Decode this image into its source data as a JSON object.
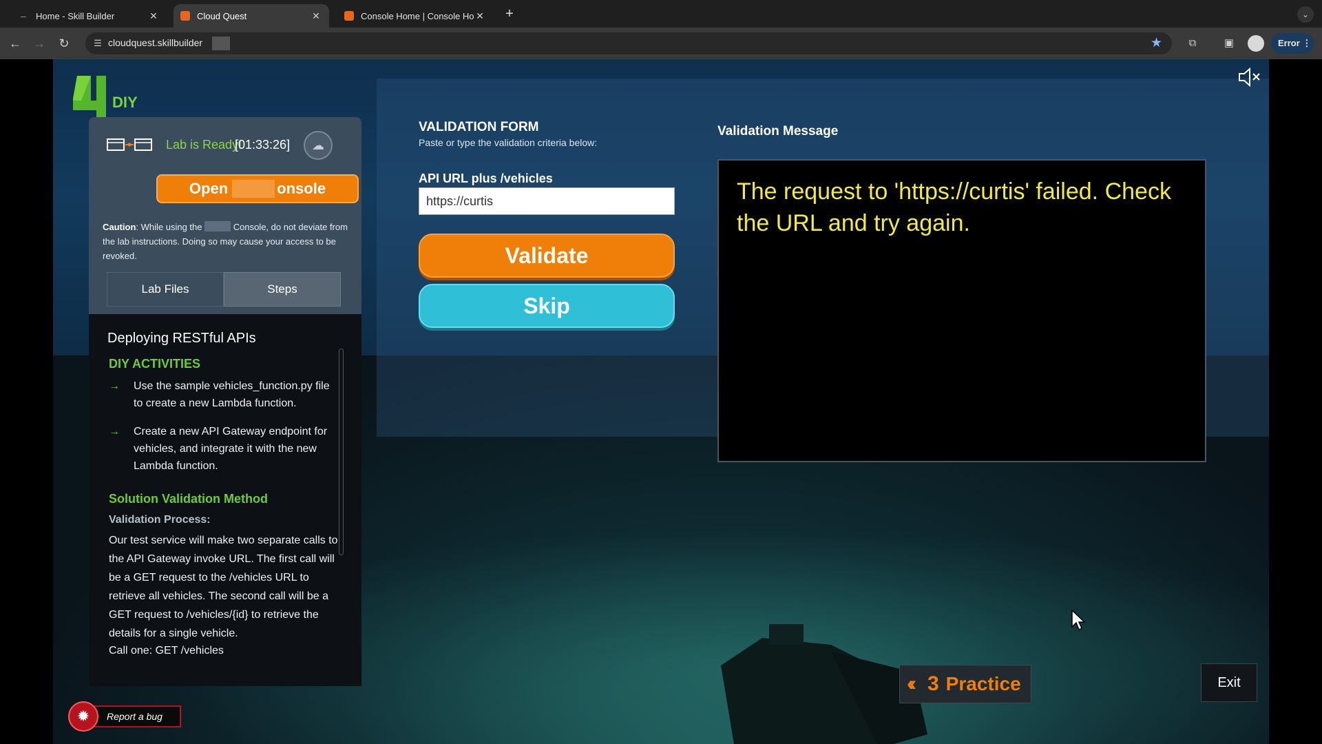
{
  "browser": {
    "tabs": [
      {
        "title": "Home - Skill Builder",
        "active": false
      },
      {
        "title": "Cloud Quest",
        "active": true
      },
      {
        "title": "Console Home | Console Ho",
        "active": false
      }
    ],
    "url": "cloudquest.skillbuilder",
    "error_chip": "Error"
  },
  "game": {
    "level_number": "4",
    "mode_label": "DIY",
    "lab": {
      "status": "Lab is Ready!",
      "timer": "[01:33:26]",
      "open_button_part1": "Open",
      "open_button_part2": "onsole",
      "caution_label": "Caution",
      "caution_text_1": ": While using the ",
      "caution_text_2": " Console, do not deviate from the lab instructions. Doing so may cause your access to be revoked.",
      "tab_lab_files": "Lab Files",
      "tab_steps": "Steps"
    },
    "steps": {
      "title": "Deploying RESTful APIs",
      "diy_heading": "DIY ACTIVITIES",
      "activities": [
        "Use the sample vehicles_function.py file to create a new Lambda function.",
        "Create a new API Gateway endpoint for vehicles, and integrate it with the new Lambda function."
      ],
      "solution_heading": "Solution Validation Method",
      "validation_process_heading": "Validation Process:",
      "validation_process_text": "Our test service will make two separate calls to the API Gateway invoke URL. The first call will be a GET request to the /vehicles URL to retrieve all vehicles. The second call will be a GET request to /vehicles/{id} to retrieve the details for a single vehicle.",
      "call_one": "Call one: GET /vehicles"
    },
    "validation_form": {
      "title": "VALIDATION FORM",
      "subtitle": "Paste or type the validation criteria below:",
      "field_label": "API URL plus /vehicles",
      "field_value": "https://curtis",
      "validate_label": "Validate",
      "skip_label": "Skip"
    },
    "validation_message": {
      "title": "Validation Message",
      "text": "The request to 'https://curtis' failed. Check the URL and try again."
    },
    "practice": {
      "number": "3",
      "label": "Practice"
    },
    "exit_label": "Exit",
    "report_bug_label": "Report a bug",
    "colors": {
      "accent_orange": "#f07f0a",
      "skip_cyan": "#2fbfd6",
      "green": "#6ecb3a",
      "message_yellow": "#f2e94a"
    }
  }
}
